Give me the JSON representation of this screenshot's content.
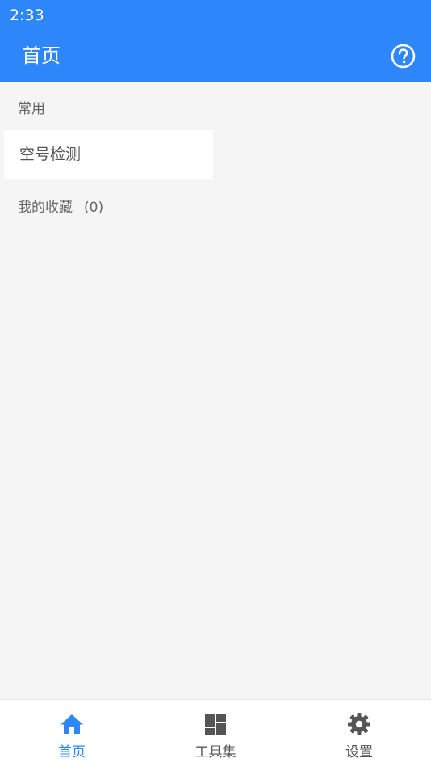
{
  "status_bar": {
    "time": "2:33"
  },
  "app_bar": {
    "title": "首页"
  },
  "content": {
    "common_label": "常用",
    "common_items": [
      {
        "label": "空号检测"
      }
    ],
    "favorites_label": "我的收藏",
    "favorites_count": "(0)"
  },
  "bottom_nav": {
    "items": [
      {
        "label": "首页",
        "icon": "home-icon",
        "active": true
      },
      {
        "label": "工具集",
        "icon": "dashboard-icon",
        "active": false
      },
      {
        "label": "设置",
        "icon": "gear-icon",
        "active": false
      }
    ]
  },
  "colors": {
    "primary": "#2d87fb",
    "background": "#f5f5f5",
    "inactive": "#555555"
  }
}
